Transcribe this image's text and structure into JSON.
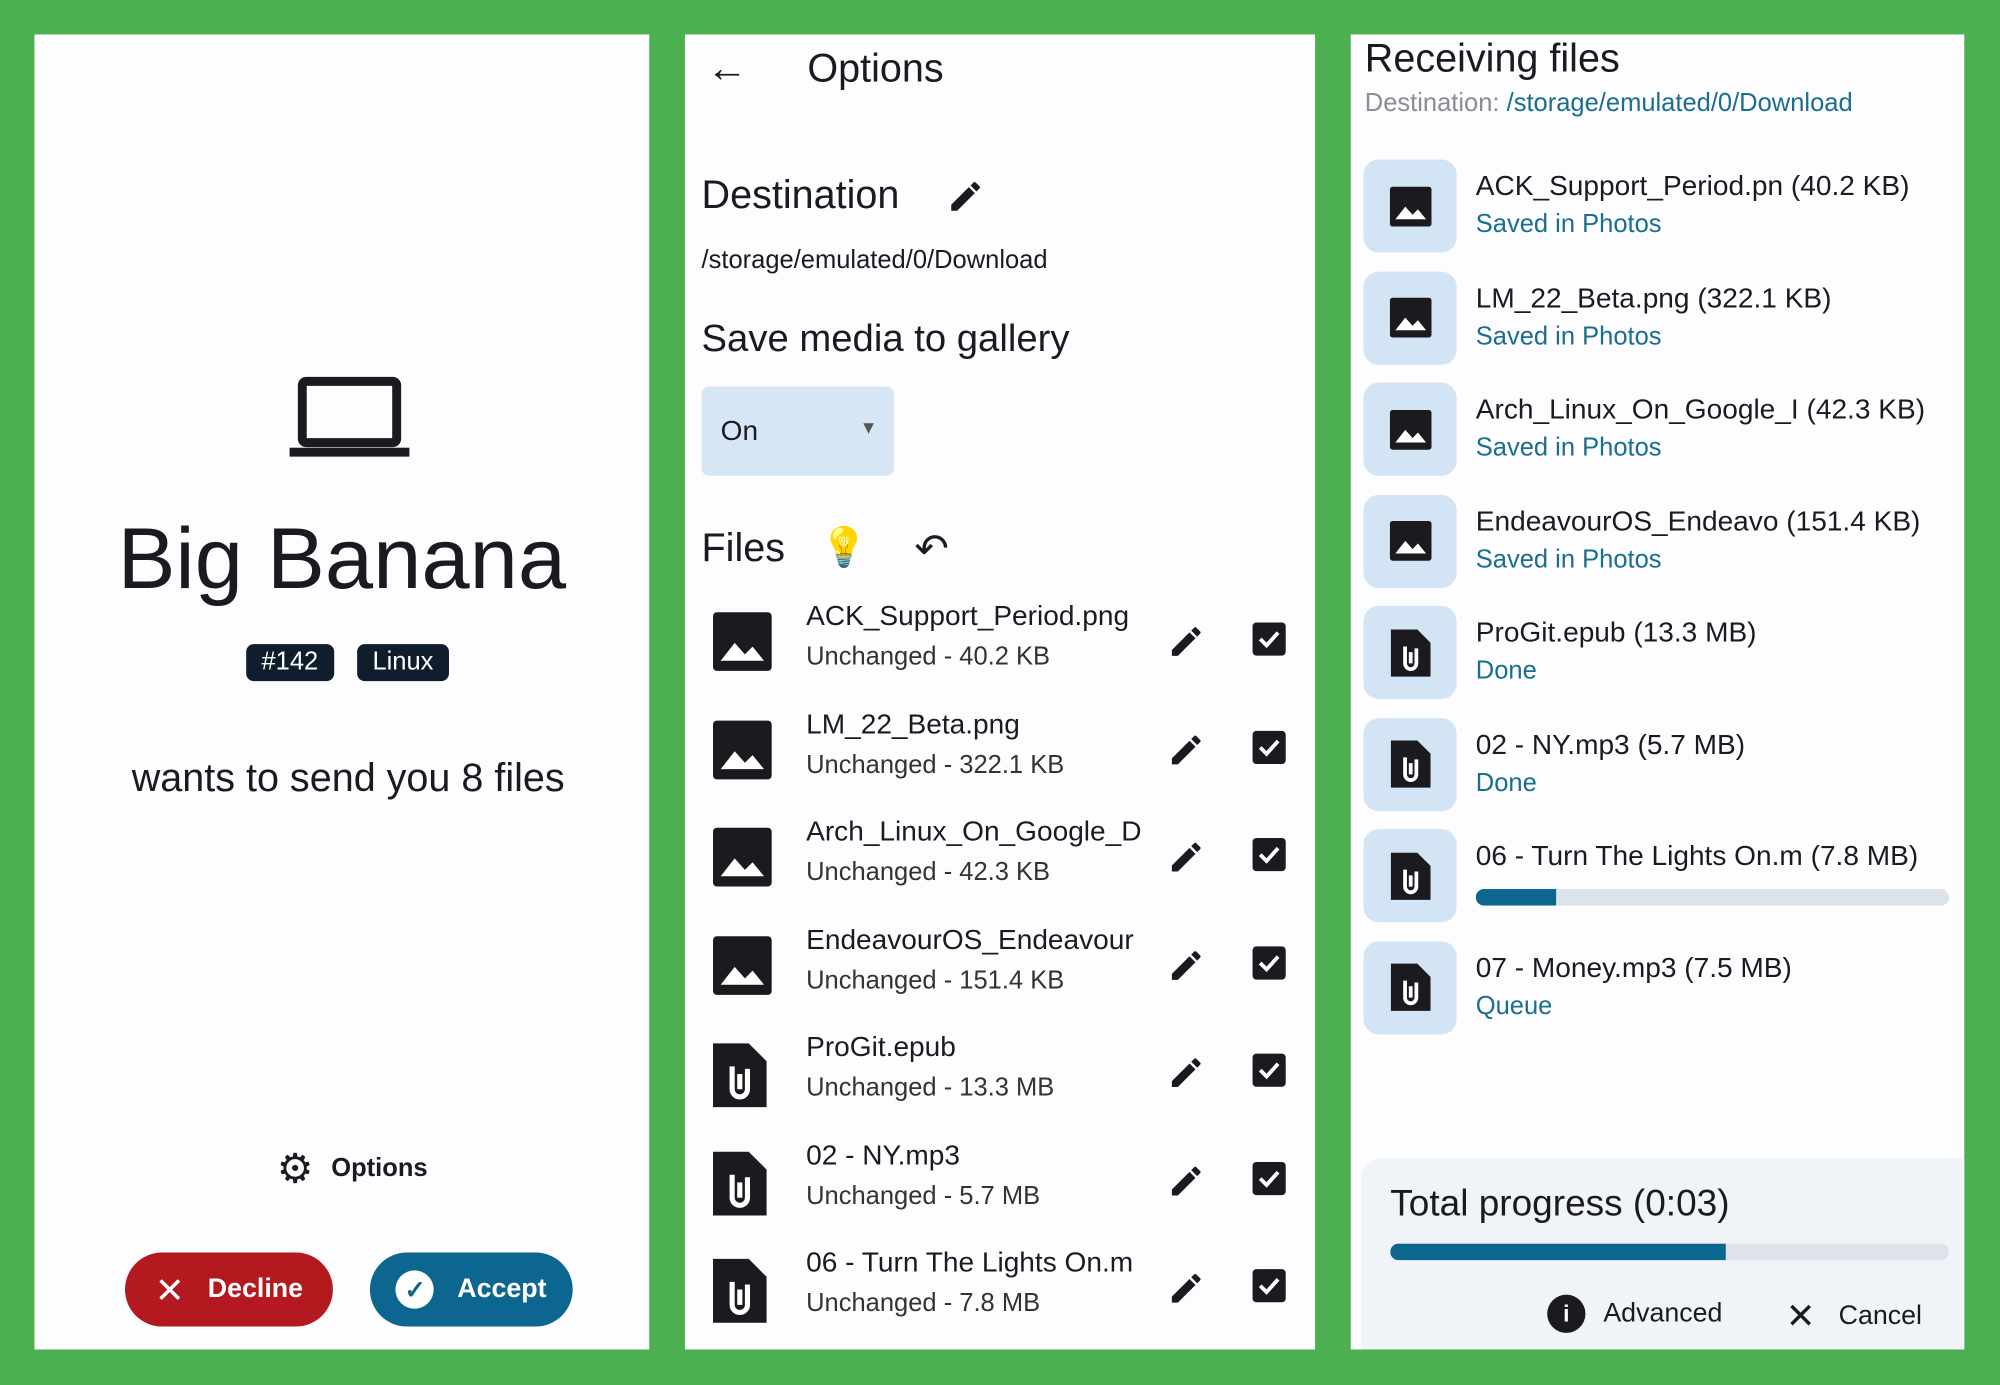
{
  "colors": {
    "background": "#4caf50",
    "decline": "#b3191e",
    "accept": "#0d668f",
    "status": "#1a6e8e",
    "chip": "#0f1d2c"
  },
  "request": {
    "device_name": "Big Banana",
    "badges": [
      "#142",
      "Linux"
    ],
    "message": "wants to send you 8 files",
    "options_label": "Options",
    "decline_label": "Decline",
    "accept_label": "Accept",
    "icon": "laptop-icon"
  },
  "options": {
    "title": "Options",
    "destination_label": "Destination",
    "destination_path": "/storage/emulated/0/Download",
    "gallery_label": "Save media to gallery",
    "gallery_value": "On",
    "files_label": "Files",
    "files": [
      {
        "name": "ACK_Support_Period.png",
        "sub": "Unchanged - 40.2 KB",
        "type": "image",
        "checked": true
      },
      {
        "name": "LM_22_Beta.png",
        "sub": "Unchanged - 322.1 KB",
        "type": "image",
        "checked": true
      },
      {
        "name": "Arch_Linux_On_Google_D",
        "sub": "Unchanged - 42.3 KB",
        "type": "image",
        "checked": true
      },
      {
        "name": "EndeavourOS_Endeavour",
        "sub": "Unchanged - 151.4 KB",
        "type": "image",
        "checked": true
      },
      {
        "name": "ProGit.epub",
        "sub": "Unchanged - 13.3 MB",
        "type": "file",
        "checked": true
      },
      {
        "name": "02 - NY.mp3",
        "sub": "Unchanged - 5.7 MB",
        "type": "file",
        "checked": true
      },
      {
        "name": "06 - Turn The Lights On.m",
        "sub": "Unchanged - 7.8 MB",
        "type": "file",
        "checked": true
      }
    ]
  },
  "receiving": {
    "title": "Receiving files",
    "destination_label": "Destination:",
    "destination_path": "/storage/emulated/0/Download",
    "files": [
      {
        "name": "ACK_Support_Period.pn",
        "size": "(40.2 KB)",
        "status": "Saved in Photos",
        "type": "image"
      },
      {
        "name": "LM_22_Beta.png",
        "size": "(322.1 KB)",
        "status": "Saved in Photos",
        "type": "image"
      },
      {
        "name": "Arch_Linux_On_Google_I",
        "size": "(42.3 KB)",
        "status": "Saved in Photos",
        "type": "image"
      },
      {
        "name": "EndeavourOS_Endeavo",
        "size": "(151.4 KB)",
        "status": "Saved in Photos",
        "type": "image"
      },
      {
        "name": "ProGit.epub",
        "size": "(13.3 MB)",
        "status": "Done",
        "type": "file"
      },
      {
        "name": "02 - NY.mp3",
        "size": "(5.7 MB)",
        "status": "Done",
        "type": "file"
      },
      {
        "name": "06 - Turn The Lights On.m",
        "size": "(7.8 MB)",
        "status": null,
        "progress": 0.17,
        "type": "file"
      },
      {
        "name": "07 - Money.mp3",
        "size": "(7.5 MB)",
        "status": "Queue",
        "type": "file"
      }
    ],
    "total_label": "Total progress (0:03)",
    "total_progress": 0.6,
    "advanced_label": "Advanced",
    "cancel_label": "Cancel"
  }
}
